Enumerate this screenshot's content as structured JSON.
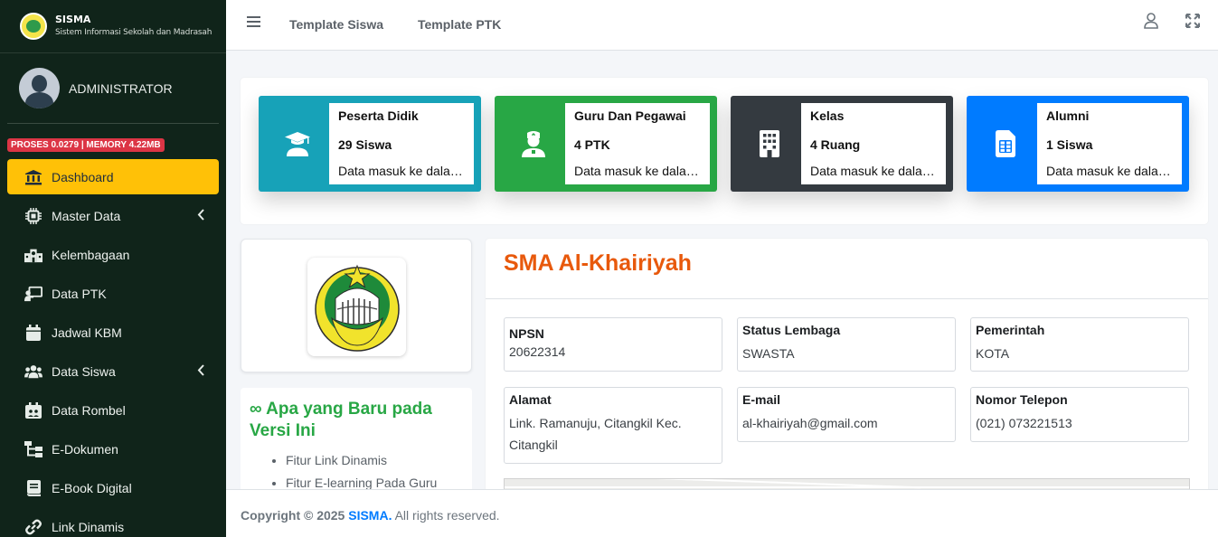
{
  "brand": {
    "name": "SISMA",
    "subtitle": "Sistem Informasi Sekolah dan Madrasah"
  },
  "user": {
    "name": "ADMINISTRATOR"
  },
  "perf_badge": "PROSES 0.0279 | MEMORY 4.22MB",
  "menu": [
    {
      "label": "Dashboard",
      "icon": "university-icon",
      "active": true
    },
    {
      "label": "Master Data",
      "icon": "chip-icon",
      "has_children": true
    },
    {
      "label": "Kelembagaan",
      "icon": "school-building-icon"
    },
    {
      "label": "Data PTK",
      "icon": "chalkboard-teacher-icon"
    },
    {
      "label": "Jadwal KBM",
      "icon": "calendar-icon"
    },
    {
      "label": "Data Siswa",
      "icon": "users-icon",
      "has_children": true
    },
    {
      "label": "Data Rombel",
      "icon": "calendar-group-icon"
    },
    {
      "label": "E-Dokumen",
      "icon": "sitemap-icon"
    },
    {
      "label": "E-Book Digital",
      "icon": "book-icon"
    },
    {
      "label": "Link Dinamis",
      "icon": "link-icon"
    }
  ],
  "topbar": {
    "links": [
      "Template Siswa",
      "Template PTK"
    ]
  },
  "info_boxes": [
    {
      "title": "Peserta Didik",
      "count": "29 Siswa",
      "desc": "Data masuk ke dalam sistem",
      "color": "#17a2b8",
      "icon": "graduate-icon"
    },
    {
      "title": "Guru Dan Pegawai",
      "count": "4 PTK",
      "desc": "Data masuk ke dalam sistem",
      "color": "#28a745",
      "icon": "nurse-icon"
    },
    {
      "title": "Kelas",
      "count": "4 Ruang",
      "desc": "Data masuk ke dalam sistem",
      "color": "#343a40",
      "icon": "building-icon"
    },
    {
      "title": "Alumni",
      "count": "1 Siswa",
      "desc": "Data masuk ke dalam sistem",
      "color": "#007bff",
      "icon": "sim-card-icon"
    }
  ],
  "news": {
    "title": "∞ Apa yang Baru pada Versi Ini",
    "items": [
      "Fitur Link Dinamis",
      "Fitur E-learning Pada Guru"
    ]
  },
  "school": {
    "name": "SMA Al-Khairiyah",
    "fields": [
      {
        "label": "NPSN",
        "value": "20622314"
      },
      {
        "label": "Status Lembaga",
        "value": "SWASTA"
      },
      {
        "label": "Pemerintah",
        "value": "KOTA"
      },
      {
        "label": "Alamat",
        "value": "Link. Ramanuju, Citangkil Kec. Citangkil"
      },
      {
        "label": "E-mail",
        "value": "al-khairiyah@gmail.com"
      },
      {
        "label": "Nomor Telepon",
        "value": "(021) 073221513"
      }
    ]
  },
  "footer": {
    "prefix": "Copyright © 2025",
    "brand": "SISMA.",
    "suffix": "All rights reserved."
  }
}
